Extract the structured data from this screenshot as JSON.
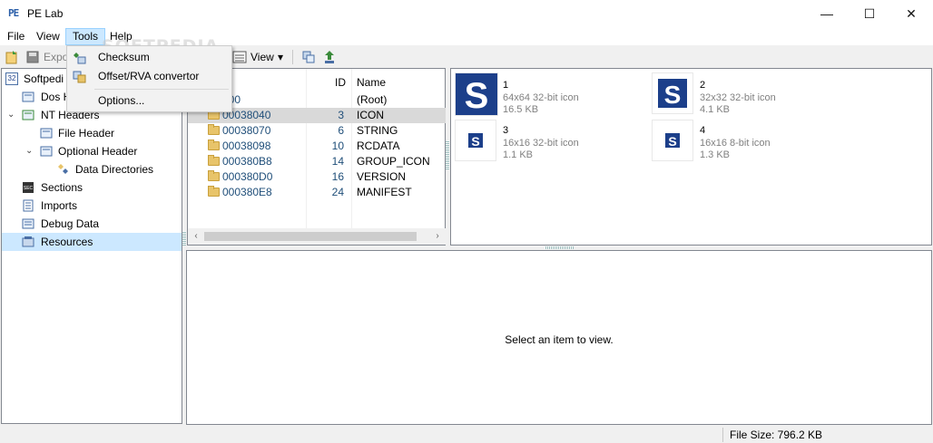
{
  "window": {
    "title": "PE Lab",
    "app_icon_text": "PE",
    "minimize_glyph": "—",
    "maximize_glyph": "☐",
    "close_glyph": "✕"
  },
  "menu": {
    "items": [
      "File",
      "View",
      "Tools",
      "Help"
    ],
    "active": "Tools"
  },
  "tools_menu": {
    "items": [
      {
        "label": "Checksum",
        "icon": "checksum-icon"
      },
      {
        "label": "Offset/RVA convertor",
        "icon": "convertor-icon"
      },
      {
        "label": "Options...",
        "icon": ""
      }
    ]
  },
  "toolbar": {
    "export_label": "Expo",
    "view_label": "View",
    "view_arrow": "▾"
  },
  "tree": {
    "root_badge": "32",
    "items": [
      {
        "label": "Softpedi",
        "level": 0,
        "chevron": ""
      },
      {
        "label": "Dos H",
        "level": 1,
        "chevron": ""
      },
      {
        "label": "NT Headers",
        "level": 1,
        "chevron": "⌄"
      },
      {
        "label": "File Header",
        "level": 2,
        "chevron": ""
      },
      {
        "label": "Optional Header",
        "level": 2,
        "chevron": "⌄"
      },
      {
        "label": "Data Directories",
        "level": 3,
        "chevron": ""
      },
      {
        "label": "Sections",
        "level": 1,
        "chevron": ""
      },
      {
        "label": "Imports",
        "level": 1,
        "chevron": ""
      },
      {
        "label": "Debug Data",
        "level": 1,
        "chevron": ""
      },
      {
        "label": "Resources",
        "level": 1,
        "chevron": "",
        "selected": true
      }
    ]
  },
  "resources": {
    "columns": [
      "ID",
      "Name"
    ],
    "rows": [
      {
        "offset": "000",
        "id": "",
        "name": "(Root)",
        "folder": false
      },
      {
        "offset": "00038040",
        "id": "3",
        "name": "ICON",
        "folder": true,
        "selected": true
      },
      {
        "offset": "00038070",
        "id": "6",
        "name": "STRING",
        "folder": true
      },
      {
        "offset": "00038098",
        "id": "10",
        "name": "RCDATA",
        "folder": true
      },
      {
        "offset": "000380B8",
        "id": "14",
        "name": "GROUP_ICON",
        "folder": true
      },
      {
        "offset": "000380D0",
        "id": "16",
        "name": "VERSION",
        "folder": true
      },
      {
        "offset": "000380E8",
        "id": "24",
        "name": "MANIFEST",
        "folder": true
      }
    ],
    "scroll_left_glyph": "‹",
    "scroll_right_glyph": "›"
  },
  "icons": [
    {
      "num": "1",
      "desc": "64x64 32-bit icon",
      "size": "16.5 KB"
    },
    {
      "num": "2",
      "desc": "32x32 32-bit icon",
      "size": "4.1 KB"
    },
    {
      "num": "3",
      "desc": "16x16 32-bit icon",
      "size": "1.1 KB"
    },
    {
      "num": "4",
      "desc": "16x16 8-bit icon",
      "size": "1.3 KB"
    }
  ],
  "icon_glyph": "S",
  "viewer": {
    "message": "Select an item to view."
  },
  "status": {
    "file_size": "File Size: 796.2 KB"
  },
  "watermark": "SOFTPEDIA",
  "colors": {
    "selection": "#cce8ff",
    "icon_blue": "#1c3f8a",
    "offset_text": "#1f4e79"
  }
}
